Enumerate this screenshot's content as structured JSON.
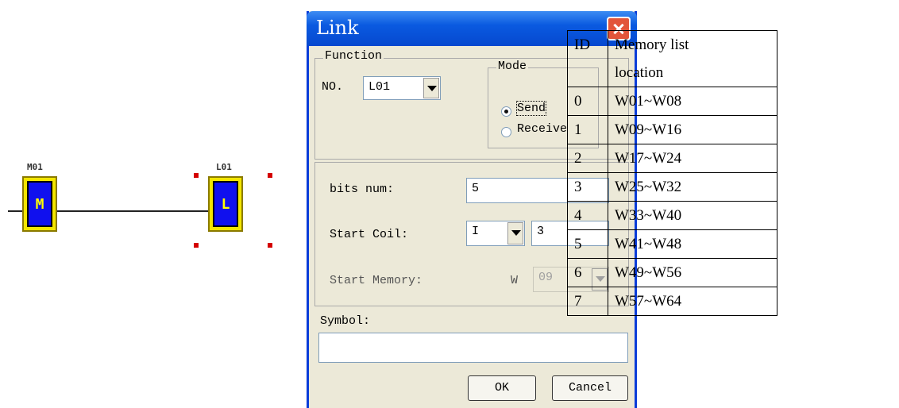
{
  "diagram": {
    "coil_m": {
      "label": "M01",
      "symbol": "M"
    },
    "coil_l": {
      "label": "L01",
      "symbol": "L"
    }
  },
  "dialog": {
    "title": "Link",
    "function_group": "Function",
    "no_label": "NO.",
    "no_value": "L01",
    "mode_group": "Mode",
    "mode_send": "Send",
    "mode_receive": "Receive",
    "mode_selected": "Send",
    "bits_num_label": "bits num:",
    "bits_num_value": "5",
    "start_coil_label": "Start Coil:",
    "start_coil_type": "I",
    "start_coil_value": "3",
    "start_memory_label": "Start Memory:",
    "start_memory_prefix": "W",
    "start_memory_value": "09",
    "symbol_label": "Symbol:",
    "symbol_value": "",
    "ok_label": "OK",
    "cancel_label": "Cancel"
  },
  "memory_table": {
    "header_id": "ID",
    "header_loc_line1": "Memory list",
    "header_loc_line2": "location",
    "rows": [
      {
        "id": "0",
        "loc": "W01~W08"
      },
      {
        "id": "1",
        "loc": "W09~W16"
      },
      {
        "id": "2",
        "loc": "W17~W24"
      },
      {
        "id": "3",
        "loc": "W25~W32"
      },
      {
        "id": "4",
        "loc": "W33~W40"
      },
      {
        "id": "5",
        "loc": "W41~W48"
      },
      {
        "id": "6",
        "loc": "W49~W56"
      },
      {
        "id": "7",
        "loc": "W57~W64"
      }
    ]
  }
}
